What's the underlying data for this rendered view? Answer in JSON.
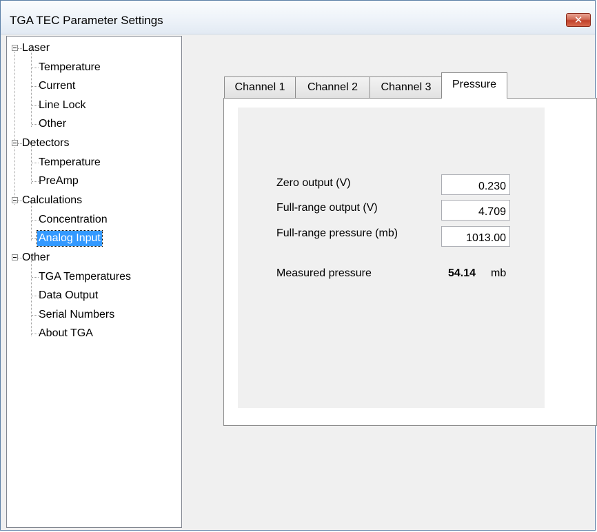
{
  "window": {
    "title": "TGA TEC Parameter Settings",
    "close_symbol": "✕"
  },
  "tree": [
    {
      "label": "Laser",
      "children": [
        "Temperature",
        "Current",
        "Line Lock",
        "Other"
      ]
    },
    {
      "label": "Detectors",
      "children": [
        "Temperature",
        "PreAmp"
      ]
    },
    {
      "label": "Calculations",
      "children": [
        "Concentration",
        "Analog Input"
      ]
    },
    {
      "label": "Other",
      "children": [
        "TGA Temperatures",
        "Data Output",
        "Serial Numbers",
        "About TGA"
      ]
    }
  ],
  "selected_node": "Analog Input",
  "tabs": [
    "Channel 1",
    "Channel 2",
    "Channel 3",
    "Pressure"
  ],
  "active_tab": "Pressure",
  "pressure": {
    "zero_output_label": "Zero output (V)",
    "zero_output_value": "0.230",
    "full_range_output_label": "Full-range output (V)",
    "full_range_output_value": "4.709",
    "full_range_pressure_label": "Full-range pressure (mb)",
    "full_range_pressure_value": "1013.00",
    "measured_label": "Measured pressure",
    "measured_value": "54.14",
    "measured_unit": "mb"
  }
}
